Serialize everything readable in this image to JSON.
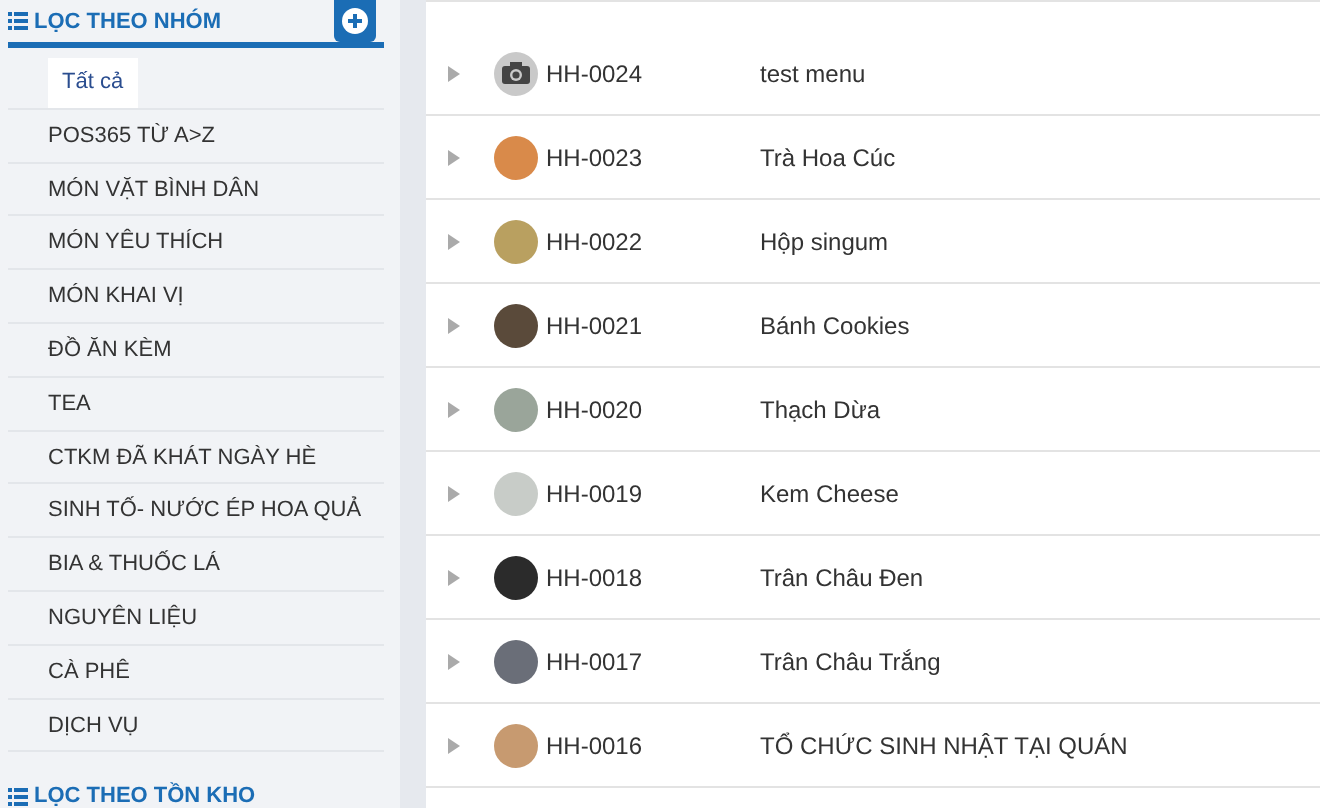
{
  "sidebar": {
    "group_filter": {
      "title": "LỌC THEO NHÓM",
      "items": [
        {
          "label": "Tất cả",
          "selected": true
        },
        {
          "label": "POS365 TỪ A>Z",
          "selected": false
        },
        {
          "label": "MÓN VẶT BÌNH DÂN",
          "selected": false
        },
        {
          "label": "MÓN YÊU THÍCH",
          "selected": false
        },
        {
          "label": "MÓN KHAI VỊ",
          "selected": false
        },
        {
          "label": "ĐỒ ĂN KÈM",
          "selected": false
        },
        {
          "label": "TEA",
          "selected": false
        },
        {
          "label": "CTKM ĐÃ KHÁT NGÀY HÈ",
          "selected": false
        },
        {
          "label": "SINH TỐ- NƯỚC ÉP HOA QUẢ",
          "selected": false
        },
        {
          "label": "BIA & THUỐC LÁ",
          "selected": false
        },
        {
          "label": "NGUYÊN LIỆU",
          "selected": false
        },
        {
          "label": "CÀ PHÊ",
          "selected": false
        },
        {
          "label": "DỊCH VỤ",
          "selected": false
        }
      ]
    },
    "stock_filter": {
      "title": "LỌC THEO TỒN KHO"
    }
  },
  "table": {
    "rows": [
      {
        "kind": "camera",
        "code": "HH-0024",
        "name": "test menu"
      },
      {
        "kind": "photo",
        "code": "HH-0023",
        "name": "Trà Hoa Cúc"
      },
      {
        "kind": "photo",
        "code": "HH-0022",
        "name": "Hộp singum"
      },
      {
        "kind": "photo",
        "code": "HH-0021",
        "name": "Bánh Cookies"
      },
      {
        "kind": "photo",
        "code": "HH-0020",
        "name": "Thạch Dừa"
      },
      {
        "kind": "photo",
        "code": "HH-0019",
        "name": "Kem Cheese"
      },
      {
        "kind": "photo",
        "code": "HH-0018",
        "name": "Trân Châu Đen"
      },
      {
        "kind": "photo",
        "code": "HH-0017",
        "name": "Trân Châu Trắng"
      },
      {
        "kind": "photo",
        "code": "HH-0016",
        "name": "TỔ CHỨC SINH NHẬT TẠI QUÁN"
      }
    ]
  }
}
